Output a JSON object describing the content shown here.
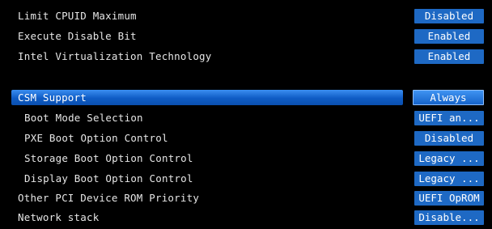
{
  "settings": [
    {
      "label": "Limit CPUID Maximum",
      "value": "Disabled"
    },
    {
      "label": "Execute Disable Bit",
      "value": "Enabled"
    },
    {
      "label": "Intel Virtualization Technology",
      "value": "Enabled"
    }
  ],
  "csm": {
    "label": "CSM Support",
    "value": "Always",
    "options": [
      {
        "label": "Boot Mode Selection",
        "value": "UEFI an..."
      },
      {
        "label": "PXE Boot Option Control",
        "value": "Disabled"
      },
      {
        "label": "Storage Boot Option Control",
        "value": "Legacy ..."
      },
      {
        "label": "Display Boot Option Control",
        "value": "Legacy ..."
      }
    ]
  },
  "other": [
    {
      "label": "Other PCI Device ROM Priority",
      "value": "UEFI OpROM"
    },
    {
      "label": "Network stack",
      "value": "Disable..."
    }
  ],
  "colors": {
    "background": "#000000",
    "value_box": "#1e69c4",
    "highlight": "#0f5cc5",
    "text": "#e6e6e6"
  }
}
